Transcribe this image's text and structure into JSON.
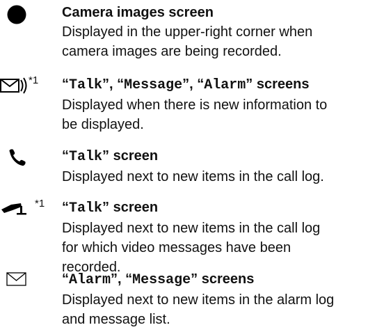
{
  "entries": [
    {
      "icon": "recording-dot-icon",
      "title_parts": [
        {
          "text": "Camera images screen",
          "mono": false
        }
      ],
      "desc_lines": [
        "Displayed in the upper-right corner when",
        "camera images are being recorded."
      ]
    },
    {
      "icon": "new-information-envelope-icon",
      "note": "*1",
      "title_parts": [
        {
          "text": "“",
          "mono": false
        },
        {
          "text": "Talk",
          "mono": true
        },
        {
          "text": "”, “",
          "mono": false
        },
        {
          "text": "Message",
          "mono": true
        },
        {
          "text": "”, “",
          "mono": false
        },
        {
          "text": "Alarm",
          "mono": true
        },
        {
          "text": "” screens",
          "mono": false
        }
      ],
      "desc_lines": [
        "Displayed when there is new information to",
        "be displayed."
      ]
    },
    {
      "icon": "phone-handset-icon",
      "title_parts": [
        {
          "text": "“",
          "mono": false
        },
        {
          "text": "Talk",
          "mono": true
        },
        {
          "text": "” screen",
          "mono": false
        }
      ],
      "desc_lines": [
        "Displayed next to new items in the call log."
      ]
    },
    {
      "icon": "video-camera-icon",
      "note": "*1",
      "title_parts": [
        {
          "text": "“",
          "mono": false
        },
        {
          "text": "Talk",
          "mono": true
        },
        {
          "text": "” screen",
          "mono": false
        }
      ],
      "desc_lines": [
        "Displayed next to new items in the call log",
        "for which video messages have been",
        "recorded."
      ]
    },
    {
      "icon": "envelope-icon",
      "title_parts": [
        {
          "text": "“",
          "mono": false
        },
        {
          "text": "Alarm",
          "mono": true
        },
        {
          "text": "”, “",
          "mono": false
        },
        {
          "text": "Message",
          "mono": true
        },
        {
          "text": "” screens",
          "mono": false
        }
      ],
      "desc_lines": [
        "Displayed next to new items in the alarm log",
        "and message list."
      ]
    }
  ]
}
